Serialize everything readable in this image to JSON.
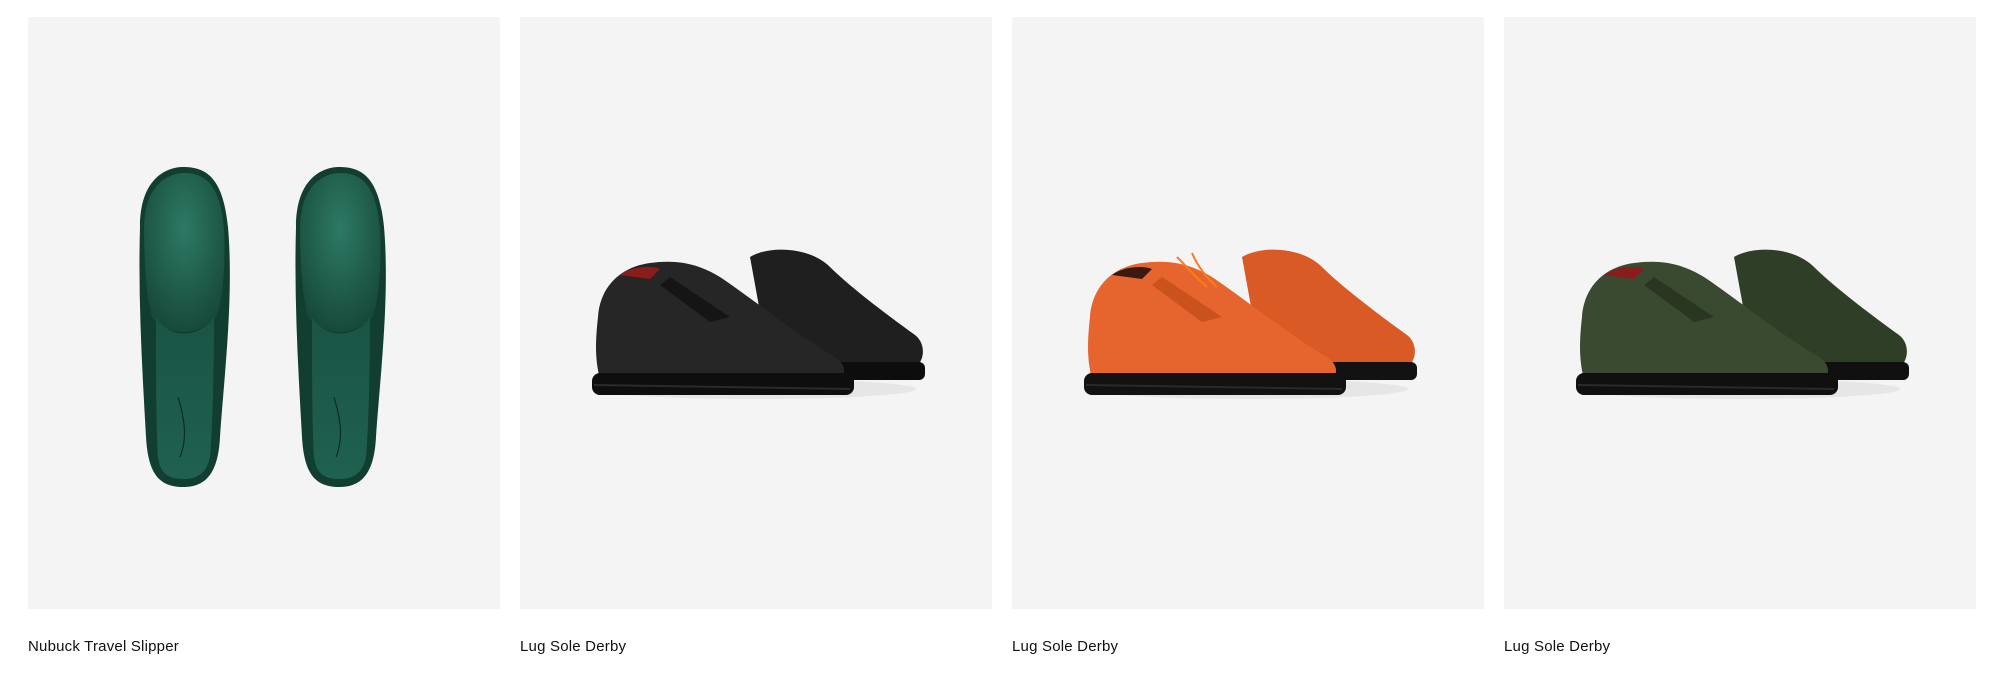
{
  "products": [
    {
      "name": "Nubuck Travel Slipper",
      "image": "green-nubuck-slipper-pair-image",
      "color": "#1f5c4c"
    },
    {
      "name": "Lug Sole Derby",
      "image": "black-derby-shoe-pair-image",
      "color": "#1d1d1d"
    },
    {
      "name": "Lug Sole Derby",
      "image": "orange-derby-shoe-pair-image",
      "color": "#e0622a"
    },
    {
      "name": "Lug Sole Derby",
      "image": "olive-derby-shoe-pair-image",
      "color": "#33442a"
    }
  ]
}
